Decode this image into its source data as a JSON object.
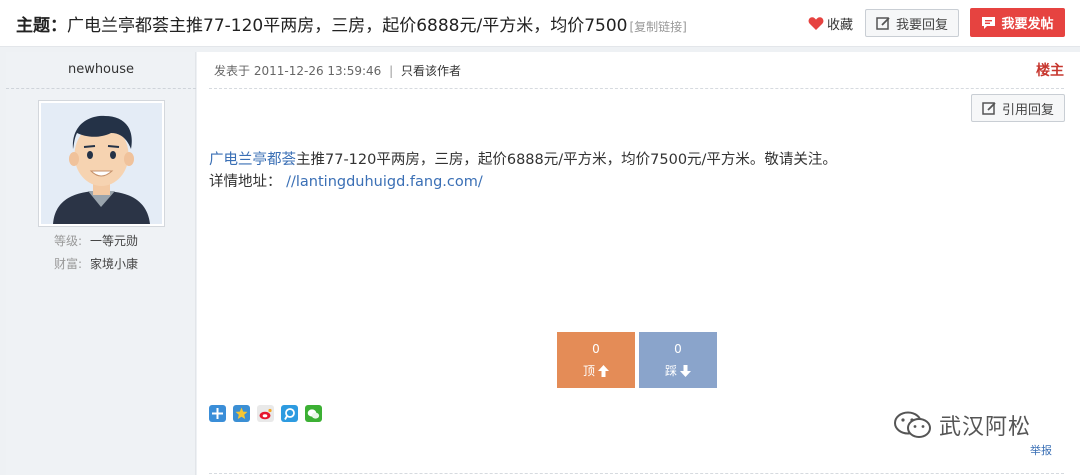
{
  "header": {
    "subject_prefix": "主题：",
    "subject_text": "广电兰亭都荟主推77-120平两房，三房，起价6888元/平方米，均价7500",
    "copy_link_label": "[复制链接]",
    "favorite_label": "收藏",
    "reply_label": "我要回复",
    "post_label": "我要发帖"
  },
  "author": {
    "name": "newhouse",
    "fields": [
      {
        "key": "等级:",
        "value": "一等元勋"
      },
      {
        "key": "财富:",
        "value": "家境小康"
      }
    ]
  },
  "post": {
    "posted_prefix": "发表于",
    "posted_time": "2011-12-26 13:59:46",
    "only_author_label": "只看该作者",
    "floor_label": "楼主",
    "quote_label": "引用回复",
    "content": {
      "line1_link": "广电兰亭都荟",
      "line1_text": "主推77-120平两房，三房，起价6888元/平方米，均价7500元/平方米。敬请关注。",
      "line2_label": "详情地址：",
      "line2_url": "//lantingduhuigd.fang.com/"
    },
    "vote_up": {
      "count": "0",
      "label": "顶"
    },
    "vote_down": {
      "count": "0",
      "label": "踩"
    },
    "share_icons": [
      "add-share-icon",
      "qzone-star-icon",
      "weibo-icon",
      "tencent-weibo-icon",
      "wechat-icon"
    ],
    "watermark_text": "武汉阿松",
    "report_label": "举报"
  },
  "colors": {
    "accent_red": "#e64340",
    "floor_red": "#c7372f",
    "link_blue": "#3a6fb5",
    "vote_up": "#e48c57",
    "vote_down": "#8aa4cb"
  }
}
